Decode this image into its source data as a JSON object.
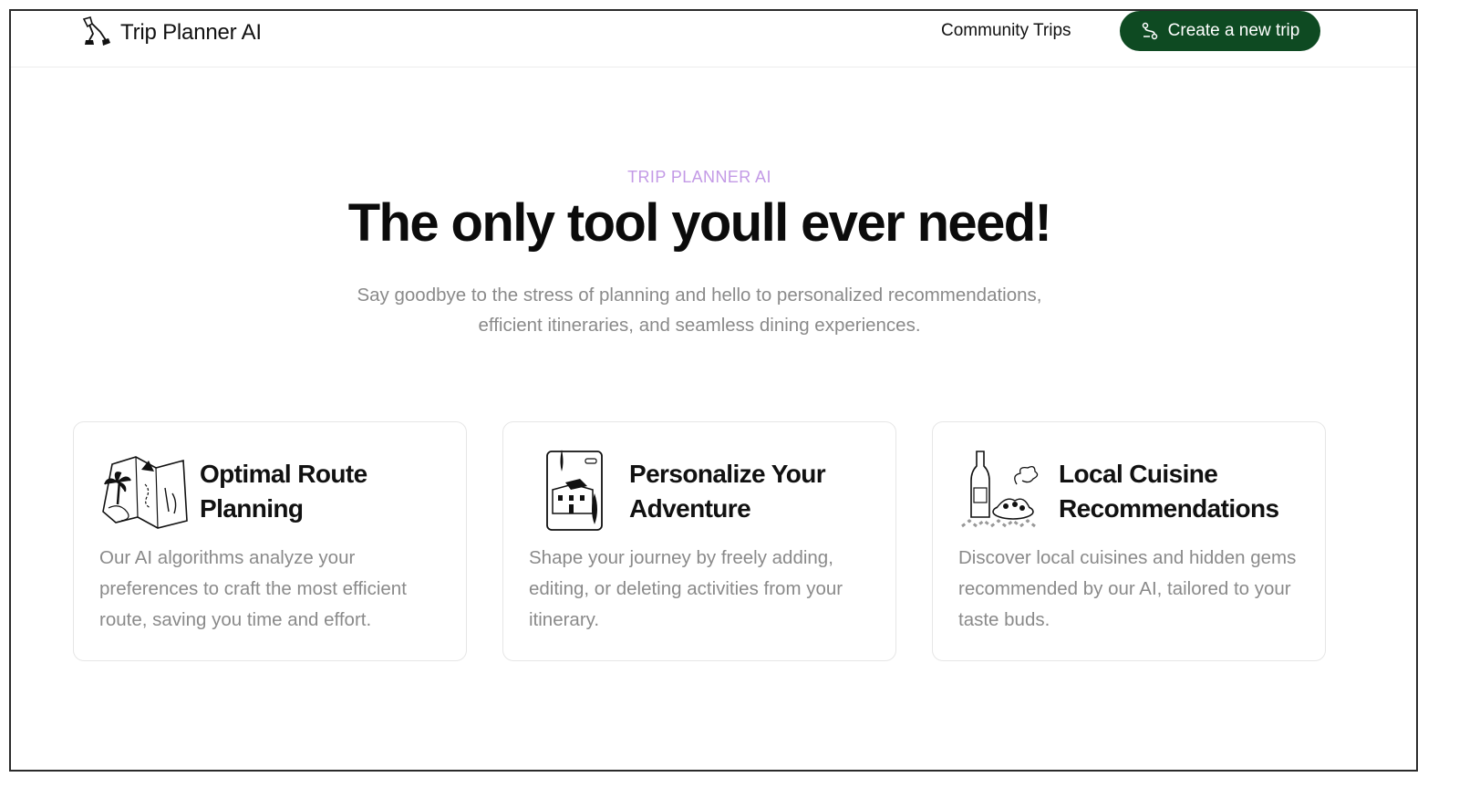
{
  "header": {
    "brand": "Trip Planner AI",
    "nav_link": "Community Trips",
    "cta_label": "Create a new trip"
  },
  "hero": {
    "eyebrow": "TRIP PLANNER AI",
    "headline": "The only tool youll ever need!",
    "subtitle": "Say goodbye to the stress of planning and hello to personalized recommendations, efficient itineraries, and seamless dining experiences."
  },
  "features": [
    {
      "title": "Optimal Route Planning",
      "body": "Our AI algorithms analyze your preferences to craft the most efficient route, saving you time and effort.",
      "icon": "map-icon"
    },
    {
      "title": "Personalize Your Adventure",
      "body": "Shape your journey by freely adding, editing, or deleting activities from your itinerary.",
      "icon": "phone-town-icon"
    },
    {
      "title": "Local Cuisine Recommendations",
      "body": "Discover local cuisines and hidden gems recommended by our AI, tailored to your taste buds.",
      "icon": "cuisine-icon"
    }
  ],
  "colors": {
    "accent_green": "#0e4a22",
    "eyebrow_purple": "#c39ae6",
    "muted_text": "#8a8a8a"
  }
}
